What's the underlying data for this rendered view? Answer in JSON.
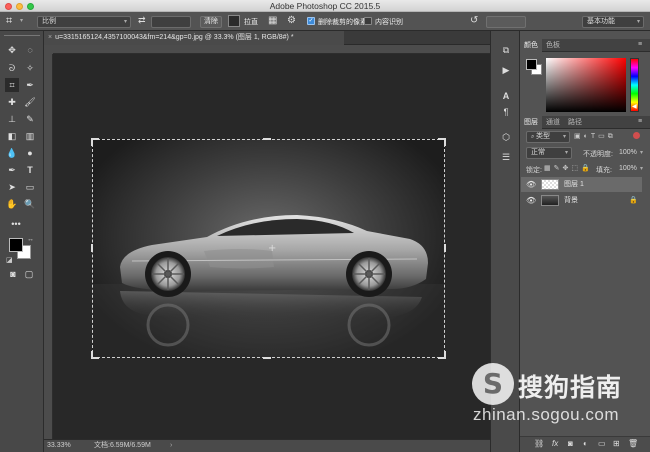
{
  "window": {
    "title": "Adobe Photoshop CC 2015.5"
  },
  "options_bar": {
    "ratio_value": "比例",
    "clear_label": "清除",
    "straighten_label": "拉直",
    "delete_cropped_label": "删除裁剪的像素",
    "content_aware_label": "内容识别",
    "workspace_value": "基本功能"
  },
  "document": {
    "tab_title": "u=3315165124,4357100043&fm=214&gp=0.jpg @ 33.3% (图层 1, RGB/8#) *",
    "zoom": "33.33%",
    "doc_info": "文档:6.59M/6.59M"
  },
  "color_panel": {
    "tabs": [
      "颜色",
      "色板"
    ],
    "foreground": "#000000",
    "background": "#ffffff",
    "hue": "#ff0000"
  },
  "layers_panel": {
    "tabs": [
      "图层",
      "通道",
      "路径"
    ],
    "filter_type": "类型",
    "blend_mode": "正常",
    "opacity_label": "不透明度:",
    "opacity_value": "100%",
    "lock_label": "锁定:",
    "fill_label": "填充:",
    "fill_value": "100%",
    "layers": [
      {
        "name": "图层 1",
        "selected": true
      },
      {
        "name": "背景",
        "selected": false
      }
    ]
  },
  "watermark": {
    "logo": "S",
    "text": "搜狗指南",
    "url": "zhinan.sogou.com"
  }
}
